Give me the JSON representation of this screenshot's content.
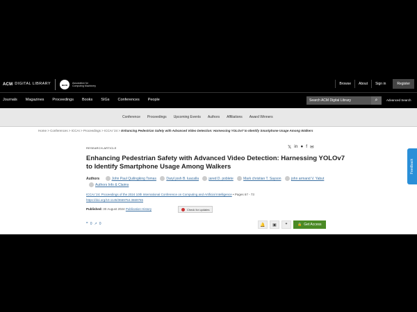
{
  "header": {
    "acm": "ACM",
    "digital_library": "DIGITAL LIBRARY",
    "assoc_badge": "acm",
    "assoc_text": "Association for Computing Machinery",
    "links": [
      "Browse",
      "About",
      "Sign in"
    ],
    "register": "Register"
  },
  "nav": {
    "items": [
      "Journals",
      "Magazines",
      "Proceedings",
      "Books",
      "SIGs",
      "Conferences",
      "People"
    ],
    "search_placeholder": "Search ACM Digital Library",
    "advanced": "Advanced Search"
  },
  "subnav": [
    "Conference",
    "Proceedings",
    "Upcoming Events",
    "Authors",
    "Affiliations",
    "Award Winners"
  ],
  "breadcrumb": {
    "path": "Home > Conferences > ICCAI > Proceedings > ICCAI '24 > ",
    "current": "Enhancing Pedestrian Safety with Advanced Video Detection: Harnessing YOLOv7 to Identify Smartphone Usage Among Walkers"
  },
  "article": {
    "type": "RESEARCH-ARTICLE",
    "title": "Enhancing Pedestrian Safety with Advanced Video Detection: Harnessing YOLOv7 to Identify Smartphone Usage Among Walkers",
    "authors_label": "Authors",
    "authors": [
      "John Paul Quilingking Tomas",
      "Daryl josh B. luacalla",
      "jared D. poblete",
      "Mark christian T. Sayson",
      "john armand V. Yabut"
    ],
    "authors_info": "Authors Info & Claims",
    "proceedings": "ICCAI '24: Proceedings of the 2024 10th International Conference on Computing and Artificial Intelligence",
    "pages": " • Pages 67 - 73",
    "doi": "https://doi.org/10.1145/3669754.3669765",
    "published_label": "Published:",
    "published_date": "30 August 2024",
    "pub_history": "Publication History",
    "check_updates": "Check for updates",
    "citations": "0",
    "downloads": "0",
    "get_access": "Get Access",
    "feedback": "Feedback"
  },
  "share_icons": [
    "x-icon",
    "linkedin-icon",
    "reddit-icon",
    "facebook-icon",
    "email-icon"
  ]
}
